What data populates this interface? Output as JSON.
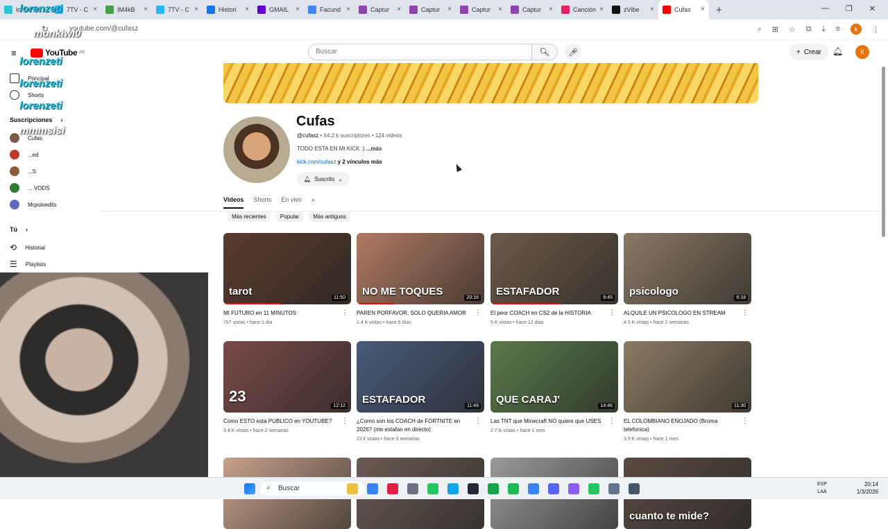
{
  "browser": {
    "tabs": [
      {
        "label": "lorenzeti",
        "color": "#2ec4d8"
      },
      {
        "label": "7TV - C",
        "color": "#29b6f6"
      },
      {
        "label": "IM4kB",
        "color": "#43a047"
      },
      {
        "label": "7TV - C",
        "color": "#29b6f6"
      },
      {
        "label": "Histori",
        "color": "#1a73e8"
      },
      {
        "label": "GMAIL",
        "color": "#6001d2"
      },
      {
        "label": "Facund",
        "color": "#4285f4"
      },
      {
        "label": "Captur",
        "color": "#8e44ad"
      },
      {
        "label": "Captur",
        "color": "#8e44ad"
      },
      {
        "label": "Captur",
        "color": "#8e44ad"
      },
      {
        "label": "Captur",
        "color": "#8e44ad"
      },
      {
        "label": "Canción",
        "color": "#e91e63"
      },
      {
        "label": "zVibe",
        "color": "#111111"
      },
      {
        "label": "Cufas",
        "color": "#ff0000"
      }
    ],
    "url": "youtube.com/@cufasz",
    "account_initial": "k"
  },
  "youtube": {
    "logo": "YouTube",
    "region": "AR",
    "search_placeholder": "Buscar",
    "create_label": "Crear",
    "avatar_initial": "k"
  },
  "sidebar": {
    "items": [
      {
        "label": "Principal",
        "icon": "home-icon"
      },
      {
        "label": "Shorts",
        "icon": "shorts-icon"
      }
    ],
    "subs_header": "Suscripciones",
    "subscriptions": [
      {
        "label": "Cufas",
        "color": "#7a5a48"
      },
      {
        "label": "...ed",
        "color": "#c0392b"
      },
      {
        "label": "...S",
        "color": "#8e5b3a"
      },
      {
        "label": "... VODS",
        "color": "#2e7d32"
      },
      {
        "label": "Mrpoloedits",
        "color": "#5c6bc0"
      }
    ],
    "you_header": "Tú",
    "you_items": [
      {
        "label": "Historial",
        "icon": "history-icon"
      },
      {
        "label": "Playlists",
        "icon": "playlists-icon"
      }
    ]
  },
  "overlay_chat": {
    "emotes": [
      "lorenzeti",
      "monkiwi0",
      "lorenzeti",
      "lorenzeti",
      "lorenzeti",
      "mmmsisi"
    ]
  },
  "channel": {
    "name": "Cufas",
    "handle": "@cufasz",
    "subscribers": "64.2 k suscriptores",
    "videos_count": "124 videos",
    "description": "TODO ESTA EN MI KICK :)",
    "more": "...más",
    "link": "kick.com/cufasz",
    "more_links": "y 2 vínculos más",
    "subscribed_label": "Suscrito",
    "tabs": [
      "Videos",
      "Shorts",
      "En vivo"
    ],
    "chips": [
      "Más recientes",
      "Popular",
      "Más antiguos"
    ]
  },
  "videos": [
    {
      "title": "MI FUTURO en 11 MINUTOS",
      "meta": "797 vistas • hace 1 día",
      "duration": "11:50",
      "overlay": "tarot",
      "bg": "#5a3b2e",
      "progress": 0.45
    },
    {
      "title": "PAREN PORFAVOR, SOLO QUERIA AMOR",
      "meta": "1.4 K vistas • hace 6 días",
      "duration": "20:16",
      "overlay": "NO ME TOQUES",
      "bg": "#b07a62",
      "progress": 0.3
    },
    {
      "title": "El peor COACH en CS2 de la HISTORIA",
      "meta": "5 K vistas • hace 12 días",
      "duration": "8:45",
      "overlay": "ESTAFADOR",
      "bg": "#6d5a4a",
      "progress": 0.55
    },
    {
      "title": "ALQUILE UN PSICOLOGO EN STREAM",
      "meta": "4.5 K vistas • hace 2 semanas",
      "duration": "6:18",
      "overlay": "psicologo",
      "bg": "#8a7864",
      "progress": 0
    },
    {
      "title": "Como ESTO esta PUBLICO en YOUTUBE?",
      "meta": "3.4 K vistas • hace 2 semanas",
      "duration": "12:12",
      "overlay": "23",
      "bg": "#7a4a4a",
      "progress": 0
    },
    {
      "title": "¿Como son los COACH de FORTNITE en 2026? (me estafan en directo)",
      "meta": "23 k vistas • hace 3 semanas",
      "duration": "11:49",
      "overlay": "ESTAFADOR",
      "bg": "#4a5a7a",
      "progress": 0
    },
    {
      "title": "Las TNT que Minecraft NO quiere que USES",
      "meta": "2.7 K vistas • hace 1 mes",
      "duration": "14:46",
      "overlay": "QUE CARAJ'",
      "bg": "#5a7a4a",
      "progress": 0
    },
    {
      "title": "EL COLOMBIANO ENOJADO (Broma telefonica)",
      "meta": "3.9 K vistas • hace 1 mes",
      "duration": "11:30",
      "overlay": "",
      "bg": "#8a7a62",
      "progress": 0
    },
    {
      "title": "",
      "meta": "",
      "duration": "",
      "overlay": "",
      "bg": "#c7a08a",
      "progress": 0
    },
    {
      "title": "",
      "meta": "",
      "duration": "",
      "overlay": "",
      "bg": "#6a5a52",
      "progress": 0
    },
    {
      "title": "",
      "meta": "",
      "duration": "",
      "overlay": "",
      "bg": "#9a9a9a",
      "progress": 0
    },
    {
      "title": "",
      "meta": "",
      "duration": "",
      "overlay": "cuanto te mide?",
      "bg": "#5a4a42",
      "progress": 0
    }
  ],
  "taskbar": {
    "search_label": "Buscar",
    "lang": "ESP",
    "lang2": "LAA",
    "time": "20:14",
    "date": "1/3/2026"
  }
}
